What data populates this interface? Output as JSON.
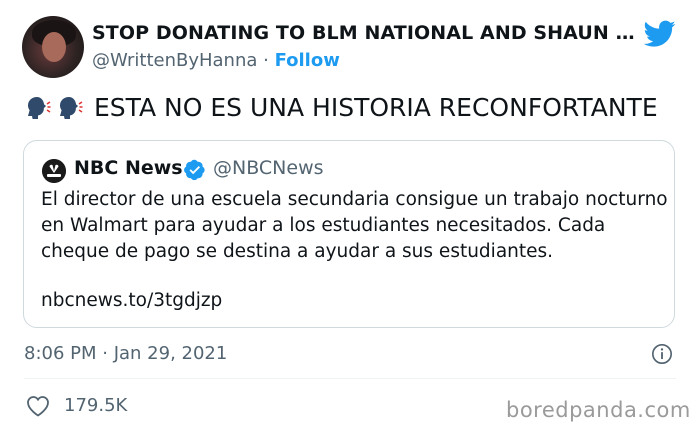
{
  "author": {
    "display_name": "STOP DONATING TO BLM NATIONAL AND SHAUN …",
    "handle": "@WrittenByHanna",
    "separator": " · ",
    "follow_label": "Follow"
  },
  "tweet": {
    "text": "ESTA NO ES UNA HISTORIA RECONFORTANTE",
    "emoji": [
      "speaking-head-icon",
      "speaking-head-icon"
    ]
  },
  "quoted_tweet": {
    "name": "NBC News",
    "handle": "@NBCNews",
    "body": "El director de una escuela secundaria consigue un trabajo nocturno en Walmart para ayudar a los estudiantes necesitados. Cada cheque de pago se destina a ayudar a sus estudiantes.",
    "link": "nbcnews.to/3tgdjzp"
  },
  "meta": {
    "timestamp": "8:06 PM · Jan 29, 2021",
    "likes": "179.5K"
  },
  "watermark": "boredpanda.com",
  "colors": {
    "accent": "#1d9bf0",
    "muted": "#536471",
    "border": "#cfd9de"
  }
}
